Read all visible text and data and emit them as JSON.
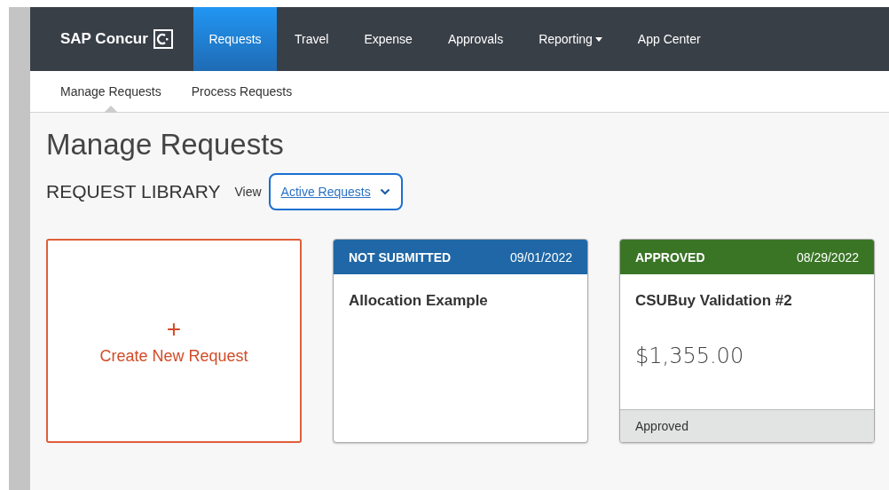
{
  "nav": {
    "brand": "SAP Concur",
    "items": [
      {
        "label": "Requests",
        "selected": true,
        "dropdown": false
      },
      {
        "label": "Travel",
        "selected": false,
        "dropdown": false
      },
      {
        "label": "Expense",
        "selected": false,
        "dropdown": false
      },
      {
        "label": "Approvals",
        "selected": false,
        "dropdown": false
      },
      {
        "label": "Reporting",
        "selected": false,
        "dropdown": true
      },
      {
        "label": "App Center",
        "selected": false,
        "dropdown": false
      }
    ]
  },
  "subnav": [
    {
      "label": "Manage Requests",
      "selected": true
    },
    {
      "label": "Process Requests",
      "selected": false
    }
  ],
  "page_title": "Manage Requests",
  "library": {
    "heading": "REQUEST LIBRARY",
    "view_label": "View",
    "view_value": "Active Requests"
  },
  "create_card": {
    "icon": "+",
    "label": "Create New Request"
  },
  "requests": [
    {
      "status": "NOT SUBMITTED",
      "date": "09/01/2022",
      "color": "#1f67a6",
      "title": "Allocation Example"
    },
    {
      "status": "APPROVED",
      "date": "08/29/2022",
      "color": "#3a7526",
      "title": "CSUBuy Validation #2",
      "amount": "$1,355.00",
      "footer": "Approved"
    }
  ]
}
